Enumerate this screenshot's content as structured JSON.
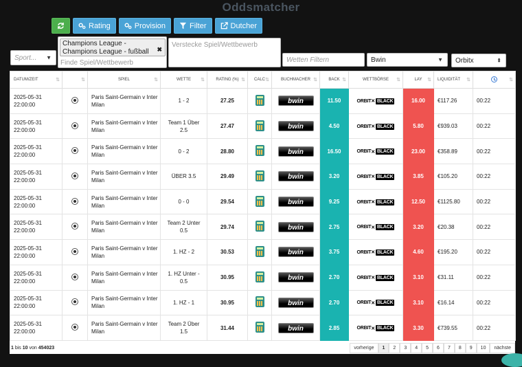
{
  "title": "Oddsmatcher",
  "toolbar": {
    "refresh_icon": "refresh-icon",
    "rating_label": "Rating",
    "provision_label": "Provision",
    "filter_label": "Filter",
    "dutcher_label": "Dutcher"
  },
  "filters": {
    "sport_placeholder": "Sport...",
    "competition_tag": "Champions League - Champions League - fußball",
    "find_placeholder": "Finde Spiel/Wettbewerb",
    "hide_placeholder": "Verstecke Spiel/Wettbewerb",
    "bets_placeholder": "Wetten Filtern",
    "bookmaker": "Bwin",
    "exchange": "Orbitx"
  },
  "table": {
    "headers": [
      "DATUM/ZEIT",
      "",
      "SPIEL",
      "WETTE",
      "RATING (%)",
      "CALC",
      "BUCHMACHER",
      "BACK",
      "WETTBÖRSE",
      "LAY",
      "LIQUIDITÄT",
      ""
    ],
    "rows": [
      {
        "date": "2025-05-31",
        "time": "22:00:00",
        "game": "Paris Saint-Germain v Inter Milan",
        "bet": "1 - 2",
        "rating": "27.25",
        "back": "11.50",
        "lay": "16.00",
        "liquidity": "€117.26",
        "starts": "00:22"
      },
      {
        "date": "2025-05-31",
        "time": "22:00:00",
        "game": "Paris Saint-Germain v Inter Milan",
        "bet": "Team 1 Über 2.5",
        "rating": "27.47",
        "back": "4.50",
        "lay": "5.80",
        "liquidity": "€939.03",
        "starts": "00:22"
      },
      {
        "date": "2025-05-31",
        "time": "22:00:00",
        "game": "Paris Saint-Germain v Inter Milan",
        "bet": "0 - 2",
        "rating": "28.80",
        "back": "16.50",
        "lay": "23.00",
        "liquidity": "€358.89",
        "starts": "00:22"
      },
      {
        "date": "2025-05-31",
        "time": "22:00:00",
        "game": "Paris Saint-Germain v Inter Milan",
        "bet": "ÜBER 3.5",
        "rating": "29.49",
        "back": "3.20",
        "lay": "3.85",
        "liquidity": "€105.20",
        "starts": "00:22"
      },
      {
        "date": "2025-05-31",
        "time": "22:00:00",
        "game": "Paris Saint-Germain v Inter Milan",
        "bet": "0 - 0",
        "rating": "29.54",
        "back": "9.25",
        "lay": "12.50",
        "liquidity": "€1125.80",
        "starts": "00:22"
      },
      {
        "date": "2025-05-31",
        "time": "22:00:00",
        "game": "Paris Saint-Germain v Inter Milan",
        "bet": "Team 2 Unter 0.5",
        "rating": "29.74",
        "back": "2.75",
        "lay": "3.20",
        "liquidity": "€20.38",
        "starts": "00:22"
      },
      {
        "date": "2025-05-31",
        "time": "22:00:00",
        "game": "Paris Saint-Germain v Inter Milan",
        "bet": "1. HZ - 2",
        "rating": "30.53",
        "back": "3.75",
        "lay": "4.60",
        "liquidity": "€195.20",
        "starts": "00:22"
      },
      {
        "date": "2025-05-31",
        "time": "22:00:00",
        "game": "Paris Saint-Germain v Inter Milan",
        "bet": "1. HZ Unter - 0.5",
        "rating": "30.95",
        "back": "2.70",
        "lay": "3.10",
        "liquidity": "€31.11",
        "starts": "00:22"
      },
      {
        "date": "2025-05-31",
        "time": "22:00:00",
        "game": "Paris Saint-Germain v Inter Milan",
        "bet": "1. HZ - 1",
        "rating": "30.95",
        "back": "2.70",
        "lay": "3.10",
        "liquidity": "€16.14",
        "starts": "00:22"
      },
      {
        "date": "2025-05-31",
        "time": "22:00:00",
        "game": "Paris Saint-Germain v Inter Milan",
        "bet": "Team 2 Über 1.5",
        "rating": "31.44",
        "back": "2.85",
        "lay": "3.30",
        "liquidity": "€739.55",
        "starts": "00:22"
      }
    ],
    "bookmaker_logo": "bwin",
    "exchange_logo_a": "ORBIT",
    "exchange_logo_b": "BLACK"
  },
  "footer": {
    "from": "1",
    "bis": "bis",
    "to": "10",
    "von": "von",
    "total": "454023",
    "prev": "vorherige",
    "pages": [
      "1",
      "2",
      "3",
      "4",
      "5",
      "6",
      "7",
      "8",
      "9",
      "10"
    ],
    "next": "nächste"
  },
  "colors": {
    "back": "#1ab3b0",
    "lay": "#ef5350",
    "button": "#4aa3d6",
    "refresh": "#4cae4c"
  }
}
